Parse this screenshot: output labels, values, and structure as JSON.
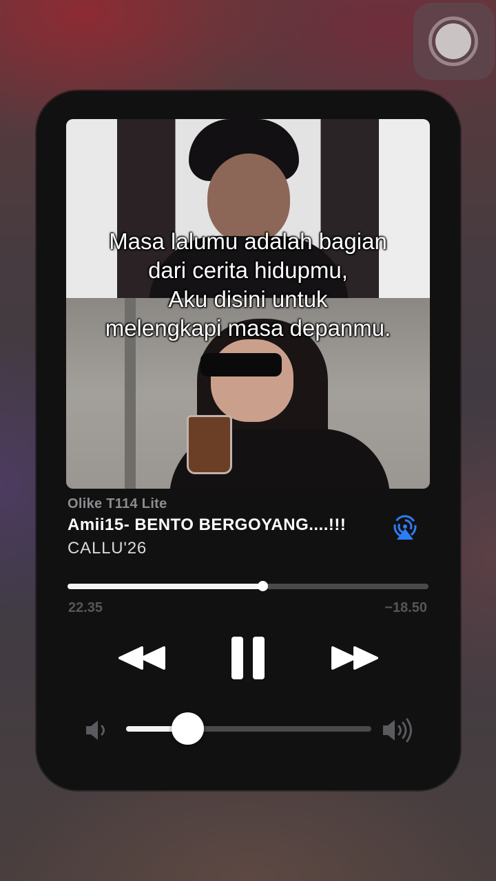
{
  "lyrics": {
    "line1": "Masa lalumu adalah bagian",
    "line2": "dari cerita hidupmu,",
    "line3": "Aku disini untuk",
    "line4": "melengkapi masa depanmu."
  },
  "now_playing": {
    "device": "Olike T114 Lite",
    "title": "Amii15- BENTO BERGOYANG....!!!",
    "artist": "CALLU'26",
    "elapsed": "22.35",
    "remaining": "−18.50",
    "progress_fraction": 0.54
  },
  "controls": {
    "rewind_icon": "rewind-icon",
    "pause_icon": "pause-icon",
    "forward_icon": "fast-forward-icon",
    "airplay_icon": "airplay-audio-icon"
  },
  "volume": {
    "level_fraction": 0.25,
    "low_icon": "speaker-low-icon",
    "high_icon": "speaker-high-icon"
  },
  "colors": {
    "accent_airplay": "#2d7cf6",
    "panel_bg": "#111112",
    "track_bg": "#4a4a4d",
    "track_fill": "#f4f4f4"
  }
}
